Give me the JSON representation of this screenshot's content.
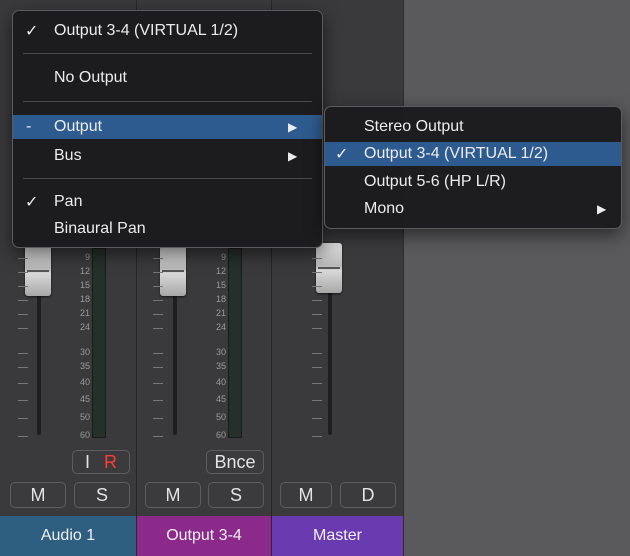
{
  "main_menu": {
    "items": [
      {
        "mark": "✓",
        "label": "Output 3-4  (VIRTUAL 1/2)"
      },
      {
        "mark": "",
        "label": "No Output"
      },
      {
        "mark": "-",
        "label": "Output",
        "submenu": true,
        "highlighted": true
      },
      {
        "mark": "",
        "label": "Bus",
        "submenu": true
      },
      {
        "mark": "✓",
        "label": "Pan"
      },
      {
        "mark": "",
        "label": "Binaural Pan"
      }
    ]
  },
  "output_submenu": {
    "items": [
      {
        "mark": "",
        "label": "Stereo Output"
      },
      {
        "mark": "✓",
        "label": "Output 3-4  (VIRTUAL 1/2)",
        "highlighted": true
      },
      {
        "mark": "",
        "label": "Output 5-6  (HP L/R)"
      },
      {
        "mark": "",
        "label": "Mono",
        "submenu": true
      }
    ]
  },
  "fader_scale": [
    "9",
    "12",
    "15",
    "18",
    "21",
    "24",
    "30",
    "35",
    "40",
    "45",
    "50",
    "60"
  ],
  "strips": [
    {
      "name": "Audio 1",
      "name_color": "#2f5f80",
      "btn_i": "I",
      "btn_r": "R",
      "mute": "M",
      "solo": "S"
    },
    {
      "name": "Output 3-4",
      "name_color": "#8c2a8c",
      "btn_bnce": "Bnce",
      "mute": "M",
      "solo": "S"
    },
    {
      "name": "Master",
      "name_color": "#6a3bb0",
      "mute": "M",
      "dim": "D"
    }
  ],
  "colors": {
    "highlight": "#2e5b8f",
    "record": "#ff3b30"
  }
}
